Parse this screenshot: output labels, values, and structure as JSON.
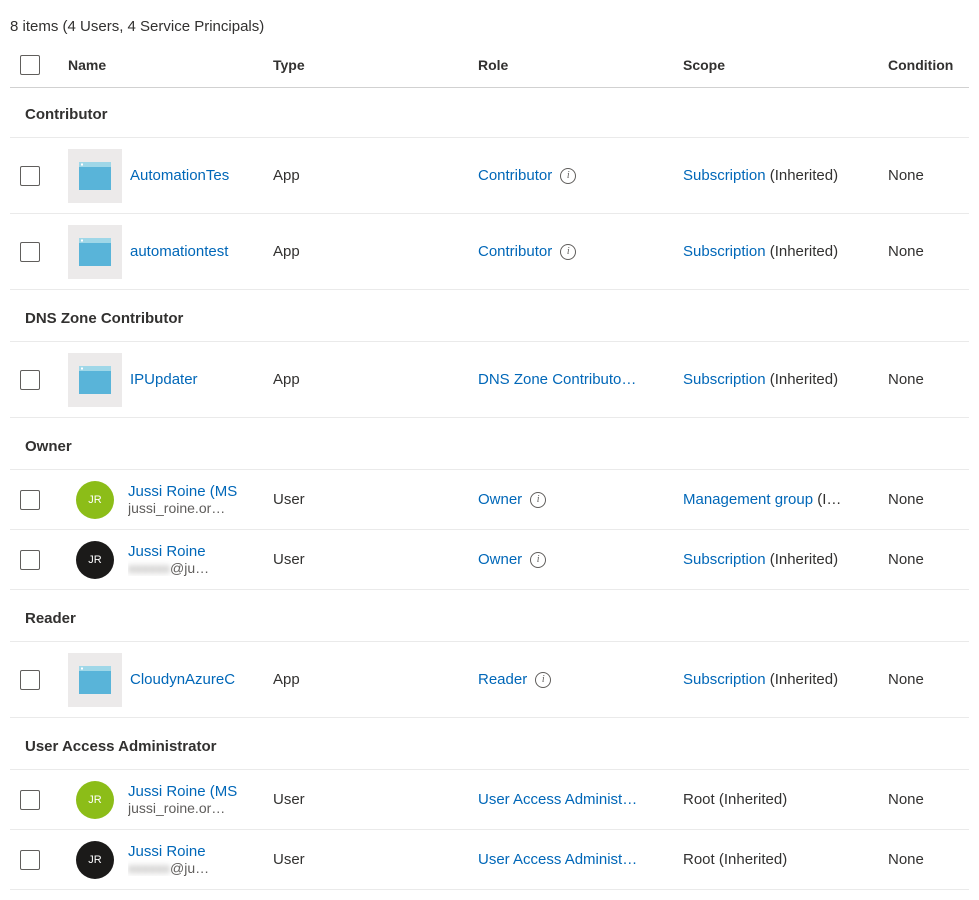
{
  "summary": "8 items (4 Users, 4 Service Principals)",
  "columns": {
    "name": "Name",
    "type": "Type",
    "role": "Role",
    "scope": "Scope",
    "condition": "Condition"
  },
  "groups": [
    {
      "title": "Contributor",
      "rows": [
        {
          "icon": "app",
          "name": "AutomationTes",
          "sub": "",
          "type": "App",
          "role": "Contributor",
          "role_info": true,
          "scope_link": "Subscription",
          "scope_suffix": " (Inherited)",
          "condition": "None",
          "compact": false
        },
        {
          "icon": "app",
          "name": "automationtest",
          "sub": "",
          "type": "App",
          "role": "Contributor",
          "role_info": true,
          "scope_link": "Subscription",
          "scope_suffix": " (Inherited)",
          "condition": "None",
          "compact": false
        }
      ]
    },
    {
      "title": "DNS Zone Contributor",
      "rows": [
        {
          "icon": "app",
          "name": "IPUpdater",
          "sub": "",
          "type": "App",
          "role": "DNS Zone Contributo…",
          "role_info": false,
          "scope_link": "Subscription",
          "scope_suffix": " (Inherited)",
          "condition": "None",
          "compact": false
        }
      ]
    },
    {
      "title": "Owner",
      "rows": [
        {
          "icon": "avatar-green",
          "initials": "JR",
          "name": "Jussi Roine (MS",
          "sub": "jussi_roine.or…",
          "type": "User",
          "role": "Owner",
          "role_info": true,
          "scope_link": "Management group",
          "scope_suffix": " (I…",
          "condition": "None",
          "compact": true
        },
        {
          "icon": "avatar-black",
          "initials": "JR",
          "name": "Jussi Roine",
          "sub_blur_front": "xxxxxx",
          "sub_blur_rest": "@ju…",
          "type": "User",
          "role": "Owner",
          "role_info": true,
          "scope_link": "Subscription",
          "scope_suffix": " (Inherited)",
          "condition": "None",
          "compact": true
        }
      ]
    },
    {
      "title": "Reader",
      "rows": [
        {
          "icon": "app",
          "name": "CloudynAzureC",
          "sub": "",
          "type": "App",
          "role": "Reader",
          "role_info": true,
          "scope_link": "Subscription",
          "scope_suffix": " (Inherited)",
          "condition": "None",
          "compact": false
        }
      ]
    },
    {
      "title": "User Access Administrator",
      "rows": [
        {
          "icon": "avatar-green",
          "initials": "JR",
          "name": "Jussi Roine (MS",
          "sub": "jussi_roine.or…",
          "type": "User",
          "role": "User Access Administ…",
          "role_info": false,
          "scope_link": "",
          "scope_suffix": "Root (Inherited)",
          "condition": "None",
          "compact": true
        },
        {
          "icon": "avatar-black",
          "initials": "JR",
          "name": "Jussi Roine",
          "sub_blur_front": "xxxxxx",
          "sub_blur_rest": "@ju…",
          "type": "User",
          "role": "User Access Administ…",
          "role_info": false,
          "scope_link": "",
          "scope_suffix": "Root (Inherited)",
          "condition": "None",
          "compact": true
        }
      ]
    }
  ]
}
